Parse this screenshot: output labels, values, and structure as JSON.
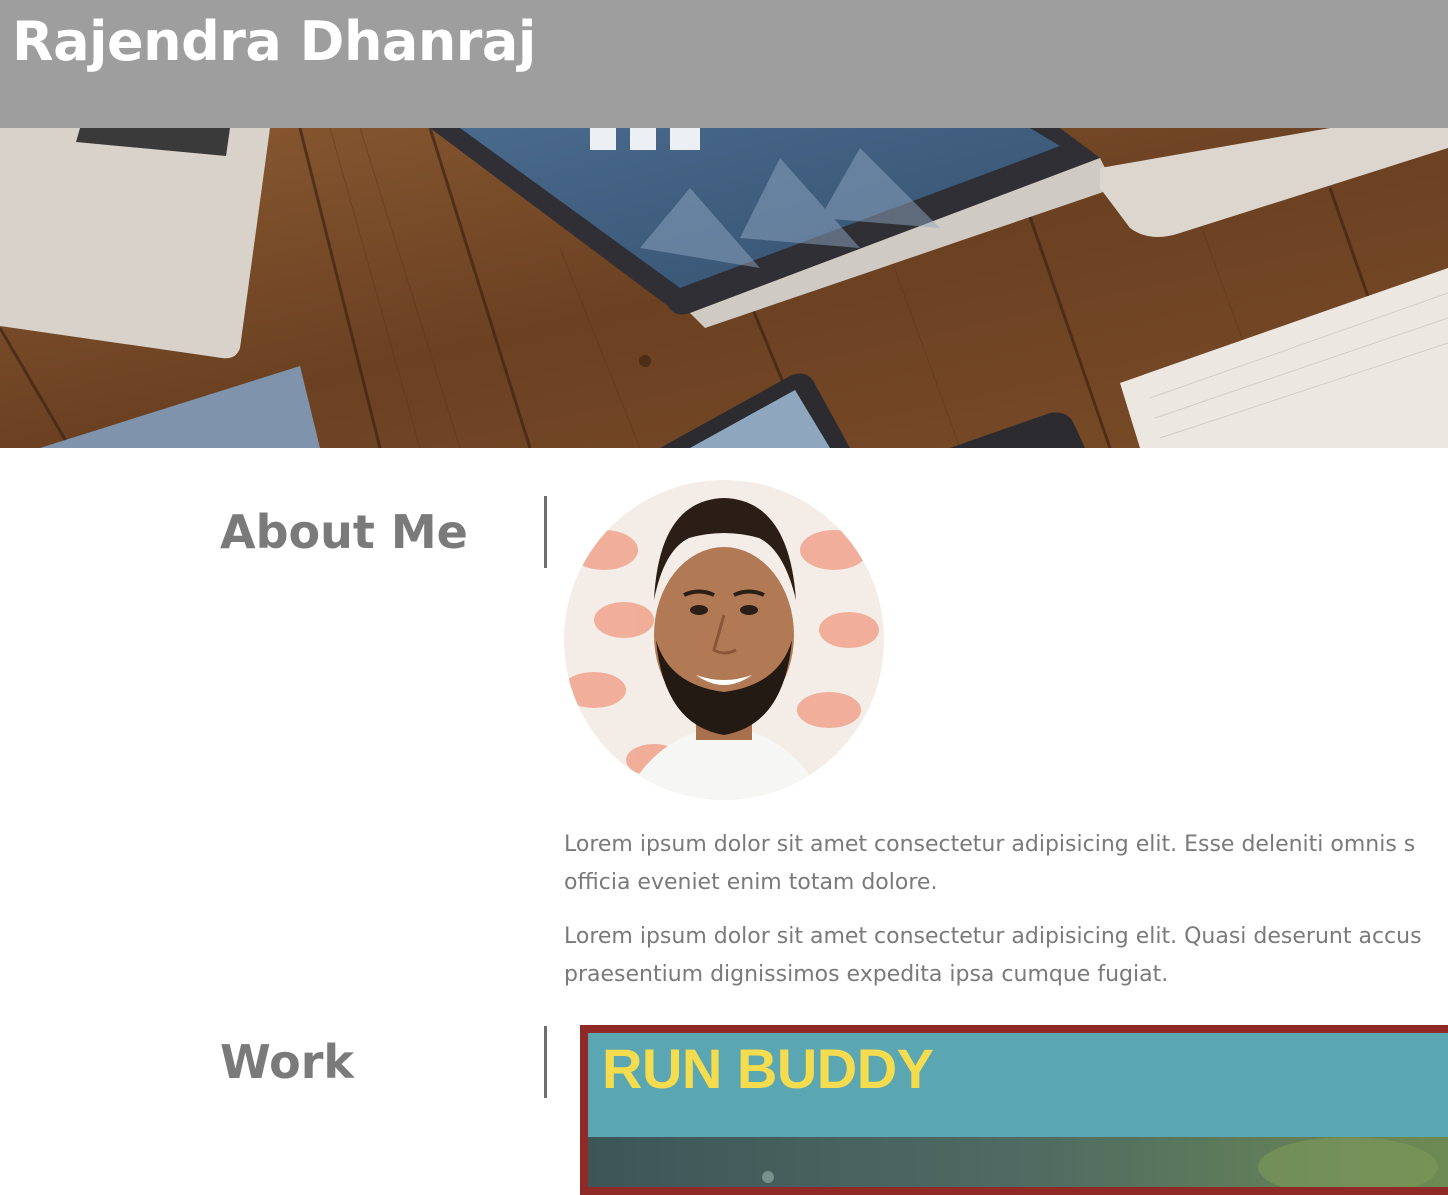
{
  "header": {
    "title": "Rajendra Dhanraj"
  },
  "about": {
    "heading": "About Me",
    "paragraphs": [
      {
        "line1": "Lorem ipsum dolor sit amet consectetur adipisicing elit. Esse deleniti omnis s",
        "line2": "officia eveniet enim totam dolore."
      },
      {
        "line1": "Lorem ipsum dolor sit amet consectetur adipisicing elit. Quasi deserunt accus",
        "line2": "praesentium dignissimos expedita ipsa cumque fugiat."
      }
    ]
  },
  "work": {
    "heading": "Work",
    "projects": [
      {
        "title": "RUN BUDDY"
      }
    ]
  },
  "colors": {
    "header_bg": "#9e9e9e",
    "heading_text": "#7a7a7a",
    "project_border": "#8f2a26",
    "project_bg": "#5aa6b2",
    "project_title": "#f4dc4e"
  }
}
